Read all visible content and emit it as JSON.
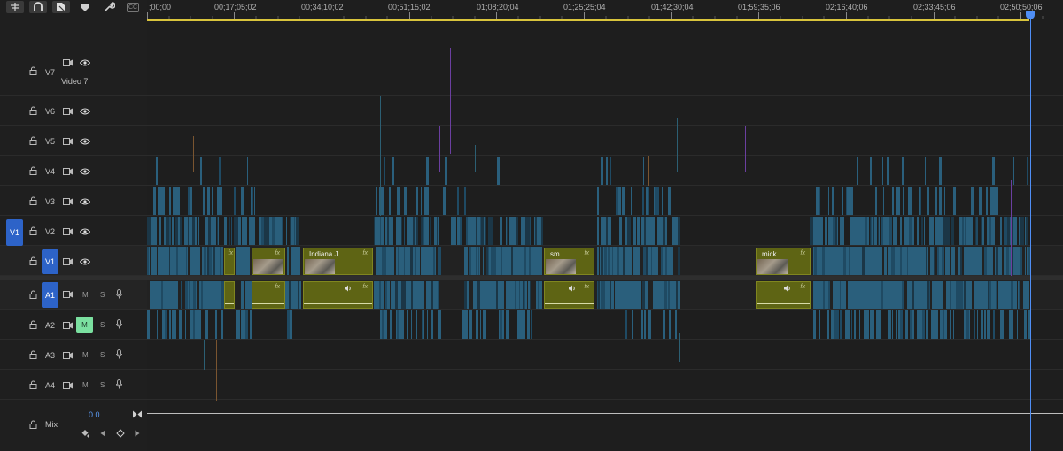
{
  "toolbar": {
    "items": [
      {
        "name": "snap-icon"
      },
      {
        "name": "linked-selection-icon"
      },
      {
        "name": "marker-tool-icon"
      },
      {
        "name": "add-marker-icon"
      },
      {
        "name": "settings-wrench-icon"
      },
      {
        "name": "captions-icon",
        "label": "CC"
      }
    ]
  },
  "ruler": {
    "timecodes": [
      ";00;00",
      "00;17;05;02",
      "00;34;10;02",
      "00;51;15;02",
      "01;08;20;04",
      "01;25;25;04",
      "01;42;30;04",
      "01;59;35;06",
      "02;16;40;06",
      "02;33;45;06",
      "02;50;50;06"
    ]
  },
  "tracks": {
    "video": [
      {
        "id": "V7",
        "label": "V7",
        "name": "Video 7"
      },
      {
        "id": "V6",
        "label": "V6"
      },
      {
        "id": "V5",
        "label": "V5"
      },
      {
        "id": "V4",
        "label": "V4"
      },
      {
        "id": "V3",
        "label": "V3"
      },
      {
        "id": "V2",
        "label": "V2",
        "source_patch": "V1"
      },
      {
        "id": "V1",
        "label": "V1",
        "targeted": true
      }
    ],
    "audio": [
      {
        "id": "A1",
        "label": "A1",
        "targeted": true,
        "mute": "M",
        "solo": "S"
      },
      {
        "id": "A2",
        "label": "A2",
        "mute": "M",
        "solo": "S",
        "muted": true
      },
      {
        "id": "A3",
        "label": "A3",
        "mute": "M",
        "solo": "S"
      },
      {
        "id": "A4",
        "label": "A4",
        "mute": "M",
        "solo": "S"
      }
    ],
    "mix": {
      "label": "Mix",
      "value": "0.0"
    }
  },
  "clips": [
    {
      "name": "",
      "fx": "fx"
    },
    {
      "name": "",
      "fx": "fx"
    },
    {
      "name": "Indiana J...",
      "fx": "fx"
    },
    {
      "name": "sm...",
      "fx": "fx"
    },
    {
      "name": "mick...",
      "fx": "fx"
    }
  ],
  "colors": {
    "accent": "#2d63c8",
    "clip_fill": "#5e6414",
    "teal_clip": "#2a5f7c",
    "playhead": "#4f8ef5",
    "work_area": "#d9c43c",
    "mute_active": "#7be0a0"
  }
}
